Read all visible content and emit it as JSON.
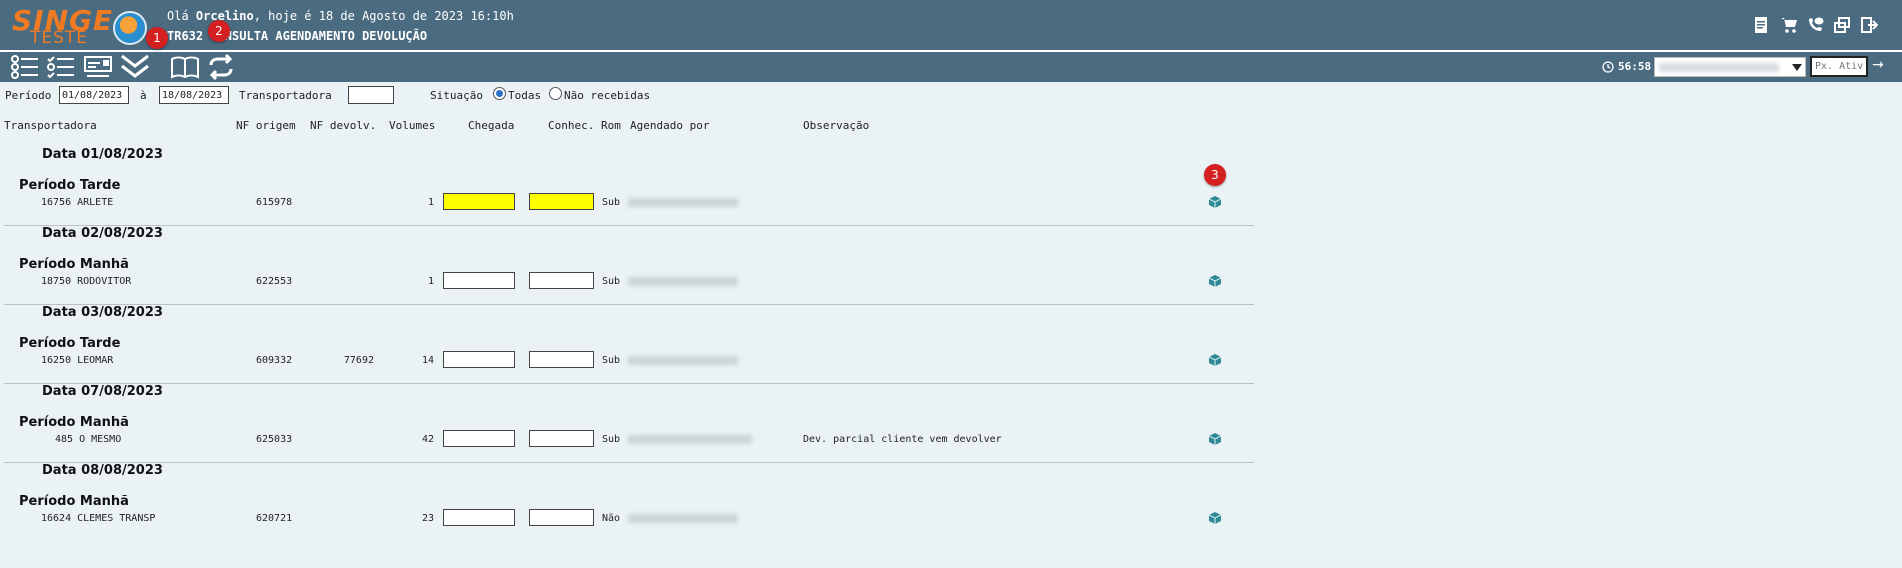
{
  "header": {
    "logo_text": "SINGE",
    "logo_sub": "TESTE",
    "greeting_prefix": "Olá ",
    "user": "Orcelino",
    "greeting_suffix": ", hoje é 18 de Agosto de 2023 16:10h",
    "screen_code": "TR632",
    "screen_title": "CONSULTA AGENDAMENTO DEVOLUÇÃO",
    "icons": [
      "document-icon",
      "cart-icon",
      "phone-chat-icon",
      "windows-icon",
      "exit-icon"
    ]
  },
  "toolbar": {
    "buttons": [
      "checklist-icon",
      "checklist-alt-icon",
      "card-icon",
      "double-chevron-down-icon",
      "book-icon",
      "refresh-icon"
    ],
    "timer": "56:58",
    "prox_placeholder": "Px. Ativ",
    "go_arrow": "→"
  },
  "badges": [
    "1",
    "2",
    "3"
  ],
  "filters": {
    "periodo_label": "Período",
    "date_from": "01/08/2023",
    "ate_label": "à",
    "date_to": "18/08/2023",
    "transportadora_label": "Transportadora",
    "transportadora_value": "",
    "situacao_label": "Situação",
    "option_todas": "Todas",
    "option_nao_recebidas": "Não recebidas",
    "selected": "Todas"
  },
  "columns": [
    "Transportadora",
    "NF origem",
    "NF devolv.",
    "Volumes",
    "Chegada",
    "Conhec. Rom",
    "Agendado por",
    "Observação"
  ],
  "groups": [
    {
      "date": "Data 01/08/2023",
      "period": "Período Tarde",
      "transportadora": "16756 ARLETE",
      "nf_origem": "615978",
      "nf_devolv": "",
      "volumes": "1",
      "chegada_highlight": true,
      "agendado_prefix": "Sub",
      "observacao": ""
    },
    {
      "date": "Data 02/08/2023",
      "period": "Período Manhã",
      "transportadora": "18750 RODOVITOR",
      "nf_origem": "622553",
      "nf_devolv": "",
      "volumes": "1",
      "chegada_highlight": false,
      "agendado_prefix": "Sub",
      "observacao": ""
    },
    {
      "date": "Data 03/08/2023",
      "period": "Período Tarde",
      "transportadora": "16250 LEOMAR",
      "nf_origem": "609332",
      "nf_devolv": "77692",
      "volumes": "14",
      "chegada_highlight": false,
      "agendado_prefix": "Sub",
      "observacao": ""
    },
    {
      "date": "Data 07/08/2023",
      "period": "Período Manhã",
      "transportadora": "485 O MESMO",
      "nf_origem": "625033",
      "nf_devolv": "",
      "volumes": "42",
      "chegada_highlight": false,
      "agendado_prefix": "Sub",
      "observacao": "Dev. parcial cliente vem devolver"
    },
    {
      "date": "Data 08/08/2023",
      "period": "Período Manhã",
      "transportadora": "16624 CLEMES TRANSP",
      "nf_origem": "620721",
      "nf_devolv": "",
      "volumes": "23",
      "chegada_highlight": false,
      "agendado_prefix": "Não",
      "observacao": ""
    }
  ]
}
